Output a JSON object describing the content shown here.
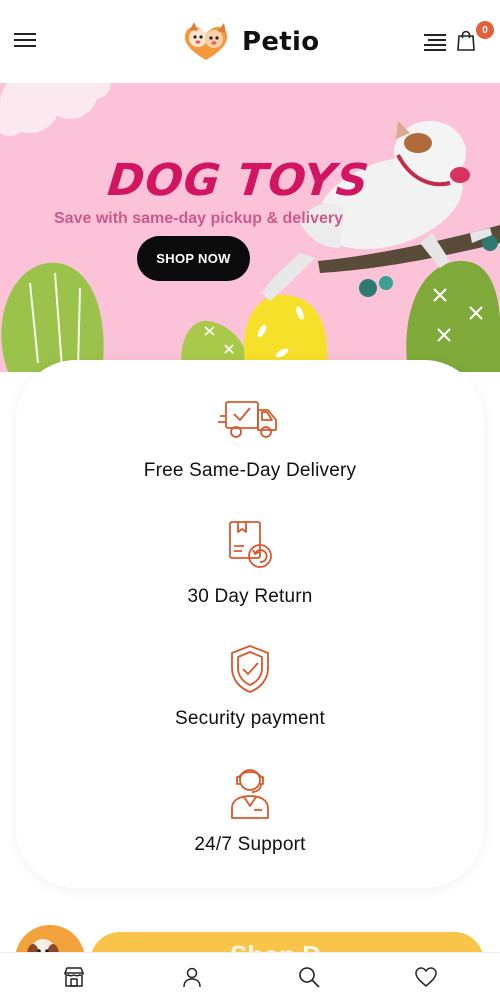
{
  "header": {
    "brand": "Petio",
    "cart_count": "0",
    "menu_icon": "hamburger-menu-icon",
    "lines_icon": "lines-menu-icon",
    "cart_icon": "shopping-bag-icon"
  },
  "banner": {
    "title": "DOG TOYS",
    "subtitle": "Save with same-day pickup & delivery",
    "button_label": "SHOP NOW"
  },
  "features": [
    {
      "label": "Free Same-Day Delivery",
      "icon": "delivery-truck-icon"
    },
    {
      "label": "30 Day Return",
      "icon": "return-box-icon"
    },
    {
      "label": "Security payment",
      "icon": "shield-check-icon"
    },
    {
      "label": "24/7 Support",
      "icon": "support-agent-icon"
    }
  ],
  "promo": {
    "partial_text": "Shop D"
  },
  "bottom_nav": [
    {
      "icon": "store-icon"
    },
    {
      "icon": "user-icon"
    },
    {
      "icon": "search-icon"
    },
    {
      "icon": "heart-icon"
    }
  ],
  "colors": {
    "accent": "#d9582b",
    "banner_bg": "#fcc2d7",
    "title_pink": "#d21561",
    "badge": "#e2603a",
    "promo_yellow": "#f8c54a"
  }
}
